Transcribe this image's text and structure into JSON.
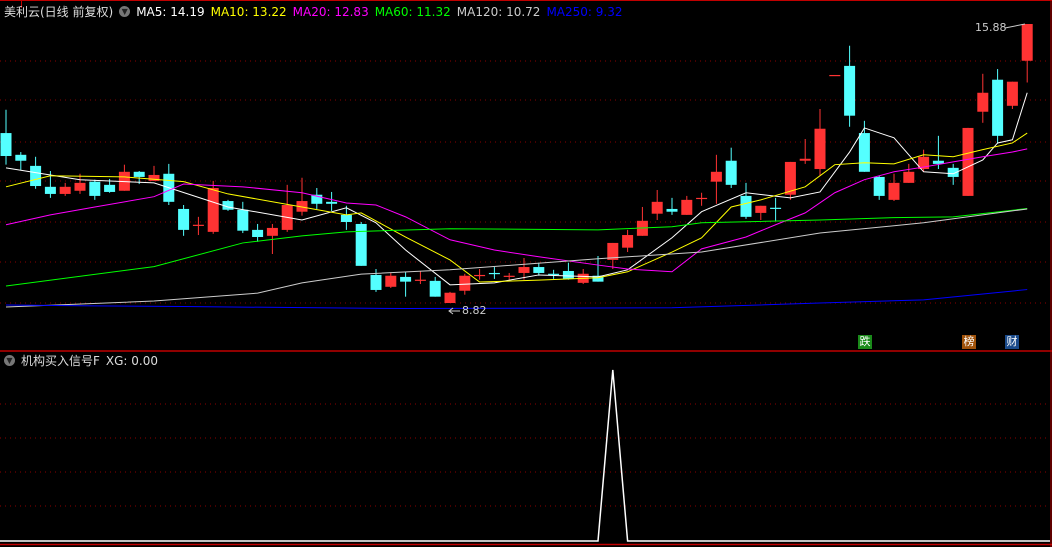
{
  "header": {
    "title": "美利云(日线 前复权)",
    "ma": [
      {
        "label": "MA5: 14.19",
        "color": "#ffffff"
      },
      {
        "label": "MA10: 13.22",
        "color": "#ffff00"
      },
      {
        "label": "MA20: 12.83",
        "color": "#ff00ff"
      },
      {
        "label": "MA60: 11.32",
        "color": "#00ff00"
      },
      {
        "label": "MA120: 10.72",
        "color": "#cccccc"
      },
      {
        "label": "MA250: 9.32",
        "color": "#0000ff"
      }
    ]
  },
  "indicator": {
    "title": "机构买入信号F",
    "value": "XG: 0.00"
  },
  "annotations": {
    "high": "15.88",
    "low": "8.82"
  },
  "badges": [
    {
      "text": "跌",
      "color": "#1a8a1a"
    },
    {
      "text": "榜",
      "color": "#a0520a"
    },
    {
      "text": "财",
      "color": "#1a4a8a"
    }
  ],
  "colors": {
    "up": "#ff3333",
    "down": "#54ffff",
    "grid": "#8b0000",
    "border": "#c00000"
  },
  "chart_data": {
    "type": "candlestick",
    "price_range": [
      8.82,
      15.88
    ],
    "ohlc": [
      [
        13.12,
        13.71,
        12.32,
        12.54
      ],
      [
        12.57,
        12.64,
        12.19,
        12.42
      ],
      [
        12.29,
        12.52,
        11.71,
        11.78
      ],
      [
        11.76,
        12.16,
        11.48,
        11.58
      ],
      [
        11.58,
        11.86,
        11.53,
        11.76
      ],
      [
        11.66,
        12.09,
        11.58,
        11.86
      ],
      [
        11.89,
        11.94,
        11.43,
        11.53
      ],
      [
        11.81,
        11.96,
        11.61,
        11.63
      ],
      [
        11.66,
        12.32,
        11.66,
        12.14
      ],
      [
        12.14,
        12.16,
        11.83,
        12.01
      ],
      [
        11.91,
        12.29,
        11.91,
        12.06
      ],
      [
        12.09,
        12.34,
        11.3,
        11.38
      ],
      [
        11.2,
        11.3,
        10.52,
        10.67
      ],
      [
        10.77,
        11.0,
        10.54,
        10.8
      ],
      [
        10.62,
        11.91,
        10.57,
        11.73
      ],
      [
        11.4,
        11.43,
        11.15,
        11.18
      ],
      [
        11.18,
        11.38,
        10.59,
        10.65
      ],
      [
        10.67,
        10.82,
        10.37,
        10.49
      ],
      [
        10.52,
        10.82,
        10.06,
        10.72
      ],
      [
        10.67,
        11.81,
        10.62,
        11.3
      ],
      [
        11.13,
        11.99,
        11.03,
        11.4
      ],
      [
        11.56,
        11.73,
        11.2,
        11.33
      ],
      [
        11.38,
        11.63,
        11.15,
        11.33
      ],
      [
        11.05,
        11.28,
        10.67,
        10.87
      ],
      [
        10.82,
        10.87,
        9.76,
        9.76
      ],
      [
        9.53,
        9.68,
        9.1,
        9.15
      ],
      [
        9.23,
        9.58,
        9.2,
        9.51
      ],
      [
        9.48,
        9.61,
        8.98,
        9.36
      ],
      [
        9.38,
        9.63,
        9.3,
        9.41
      ],
      [
        9.38,
        9.48,
        8.98,
        8.98
      ],
      [
        8.82,
        9.1,
        8.82,
        9.08
      ],
      [
        9.13,
        9.56,
        9.03,
        9.51
      ],
      [
        9.51,
        9.68,
        9.41,
        9.53
      ],
      [
        9.58,
        9.73,
        9.43,
        9.56
      ],
      [
        9.48,
        9.58,
        9.41,
        9.51
      ],
      [
        9.58,
        9.96,
        9.41,
        9.73
      ],
      [
        9.73,
        9.84,
        9.51,
        9.58
      ],
      [
        9.56,
        9.66,
        9.43,
        9.53
      ],
      [
        9.63,
        9.84,
        9.41,
        9.43
      ],
      [
        9.33,
        9.68,
        9.3,
        9.56
      ],
      [
        9.51,
        10.01,
        9.36,
        9.36
      ],
      [
        9.91,
        10.34,
        9.68,
        10.34
      ],
      [
        10.22,
        10.67,
        10.11,
        10.54
      ],
      [
        10.52,
        11.25,
        10.52,
        10.9
      ],
      [
        11.08,
        11.68,
        10.92,
        11.38
      ],
      [
        11.2,
        11.48,
        11.05,
        11.13
      ],
      [
        11.05,
        11.53,
        11.05,
        11.43
      ],
      [
        11.46,
        11.61,
        11.28,
        11.48
      ],
      [
        11.89,
        12.57,
        11.33,
        12.14
      ],
      [
        12.42,
        12.75,
        11.73,
        11.81
      ],
      [
        11.53,
        11.86,
        10.95,
        11.0
      ],
      [
        11.1,
        11.28,
        10.92,
        11.28
      ],
      [
        11.23,
        11.48,
        10.9,
        11.2
      ],
      [
        11.56,
        12.39,
        11.43,
        12.39
      ],
      [
        12.42,
        12.97,
        12.34,
        12.47
      ],
      [
        12.21,
        13.73,
        12.04,
        13.23
      ],
      [
        14.57,
        14.59,
        14.57,
        14.59
      ],
      [
        14.82,
        15.33,
        13.28,
        13.56
      ],
      [
        13.12,
        13.43,
        12.14,
        12.14
      ],
      [
        12.01,
        12.04,
        11.43,
        11.53
      ],
      [
        11.43,
        12.09,
        11.4,
        11.86
      ],
      [
        11.86,
        12.34,
        11.86,
        12.14
      ],
      [
        12.21,
        12.7,
        12.14,
        12.52
      ],
      [
        12.42,
        13.05,
        12.21,
        12.34
      ],
      [
        12.24,
        12.34,
        11.81,
        12.01
      ],
      [
        11.53,
        13.25,
        11.53,
        13.25
      ],
      [
        13.66,
        14.62,
        13.38,
        14.14
      ],
      [
        14.47,
        14.74,
        12.85,
        13.05
      ],
      [
        13.81,
        14.42,
        13.73,
        14.42
      ],
      [
        14.95,
        15.88,
        14.4,
        15.88
      ]
    ],
    "ma_series": [
      {
        "name": "MA5",
        "color": "#ffffff",
        "points": [
          [
            0,
            12.24
          ],
          [
            5,
            11.94
          ],
          [
            10,
            11.86
          ],
          [
            15,
            11.25
          ],
          [
            20,
            10.92
          ],
          [
            23,
            11.23
          ],
          [
            25,
            10.85
          ],
          [
            27,
            10.16
          ],
          [
            30,
            9.28
          ],
          [
            33,
            9.33
          ],
          [
            36,
            9.53
          ],
          [
            40,
            9.48
          ],
          [
            42,
            9.66
          ],
          [
            45,
            10.47
          ],
          [
            47,
            11.13
          ],
          [
            50,
            11.61
          ],
          [
            53,
            11.48
          ],
          [
            55,
            11.63
          ],
          [
            57,
            12.64
          ],
          [
            58,
            13.25
          ],
          [
            60,
            13.0
          ],
          [
            62,
            12.14
          ],
          [
            64,
            12.09
          ],
          [
            66,
            12.44
          ],
          [
            67,
            12.87
          ],
          [
            68,
            12.95
          ],
          [
            69,
            14.14
          ]
        ]
      },
      {
        "name": "MA10",
        "color": "#ffff00",
        "points": [
          [
            0,
            11.76
          ],
          [
            3,
            12.04
          ],
          [
            8,
            12.01
          ],
          [
            12,
            11.89
          ],
          [
            15,
            11.58
          ],
          [
            20,
            11.25
          ],
          [
            23,
            11.05
          ],
          [
            24,
            11.1
          ],
          [
            27,
            10.49
          ],
          [
            30,
            9.91
          ],
          [
            32,
            9.35
          ],
          [
            36,
            9.4
          ],
          [
            40,
            9.46
          ],
          [
            42,
            9.61
          ],
          [
            45,
            10.11
          ],
          [
            47,
            10.47
          ],
          [
            49,
            11.25
          ],
          [
            51,
            11.43
          ],
          [
            54,
            11.76
          ],
          [
            56,
            12.32
          ],
          [
            58,
            12.37
          ],
          [
            60,
            12.34
          ],
          [
            62,
            12.57
          ],
          [
            64,
            12.52
          ],
          [
            66,
            12.7
          ],
          [
            68,
            12.87
          ],
          [
            69,
            13.12
          ]
        ]
      },
      {
        "name": "MA20",
        "color": "#ff00ff",
        "points": [
          [
            0,
            10.8
          ],
          [
            3,
            11.05
          ],
          [
            6,
            11.25
          ],
          [
            10,
            11.51
          ],
          [
            12,
            11.83
          ],
          [
            16,
            11.76
          ],
          [
            20,
            11.61
          ],
          [
            23,
            11.35
          ],
          [
            25,
            11.3
          ],
          [
            27,
            11.0
          ],
          [
            30,
            10.42
          ],
          [
            33,
            10.16
          ],
          [
            36,
            9.99
          ],
          [
            40,
            9.78
          ],
          [
            42,
            9.68
          ],
          [
            45,
            9.61
          ],
          [
            47,
            10.19
          ],
          [
            50,
            10.49
          ],
          [
            52,
            10.8
          ],
          [
            54,
            11.1
          ],
          [
            56,
            11.61
          ],
          [
            58,
            11.94
          ],
          [
            60,
            12.14
          ],
          [
            62,
            12.26
          ],
          [
            64,
            12.39
          ],
          [
            66,
            12.52
          ],
          [
            68,
            12.64
          ],
          [
            69,
            12.72
          ]
        ]
      },
      {
        "name": "MA60",
        "color": "#00ff00",
        "points": [
          [
            0,
            9.25
          ],
          [
            10,
            9.74
          ],
          [
            16,
            10.34
          ],
          [
            20,
            10.52
          ],
          [
            23,
            10.62
          ],
          [
            30,
            10.7
          ],
          [
            40,
            10.67
          ],
          [
            45,
            10.75
          ],
          [
            47,
            10.85
          ],
          [
            55,
            10.92
          ],
          [
            60,
            10.98
          ],
          [
            64,
            11.0
          ],
          [
            69,
            11.21
          ]
        ]
      },
      {
        "name": "MA120",
        "color": "#cccccc",
        "points": [
          [
            0,
            8.72
          ],
          [
            10,
            8.87
          ],
          [
            17,
            9.07
          ],
          [
            20,
            9.33
          ],
          [
            24,
            9.55
          ],
          [
            30,
            9.66
          ],
          [
            40,
            9.94
          ],
          [
            47,
            10.11
          ],
          [
            55,
            10.59
          ],
          [
            62,
            10.85
          ],
          [
            69,
            11.2
          ]
        ]
      },
      {
        "name": "MA250",
        "color": "#0000ff",
        "points": [
          [
            0,
            8.77
          ],
          [
            5,
            8.75
          ],
          [
            12,
            8.73
          ],
          [
            27,
            8.68
          ],
          [
            45,
            8.7
          ],
          [
            55,
            8.82
          ],
          [
            62,
            8.9
          ],
          [
            69,
            9.16
          ]
        ]
      }
    ],
    "indicator_series": {
      "name": "XG",
      "range": [
        0,
        1
      ],
      "signal_index": 41,
      "signal_value": 1
    }
  }
}
